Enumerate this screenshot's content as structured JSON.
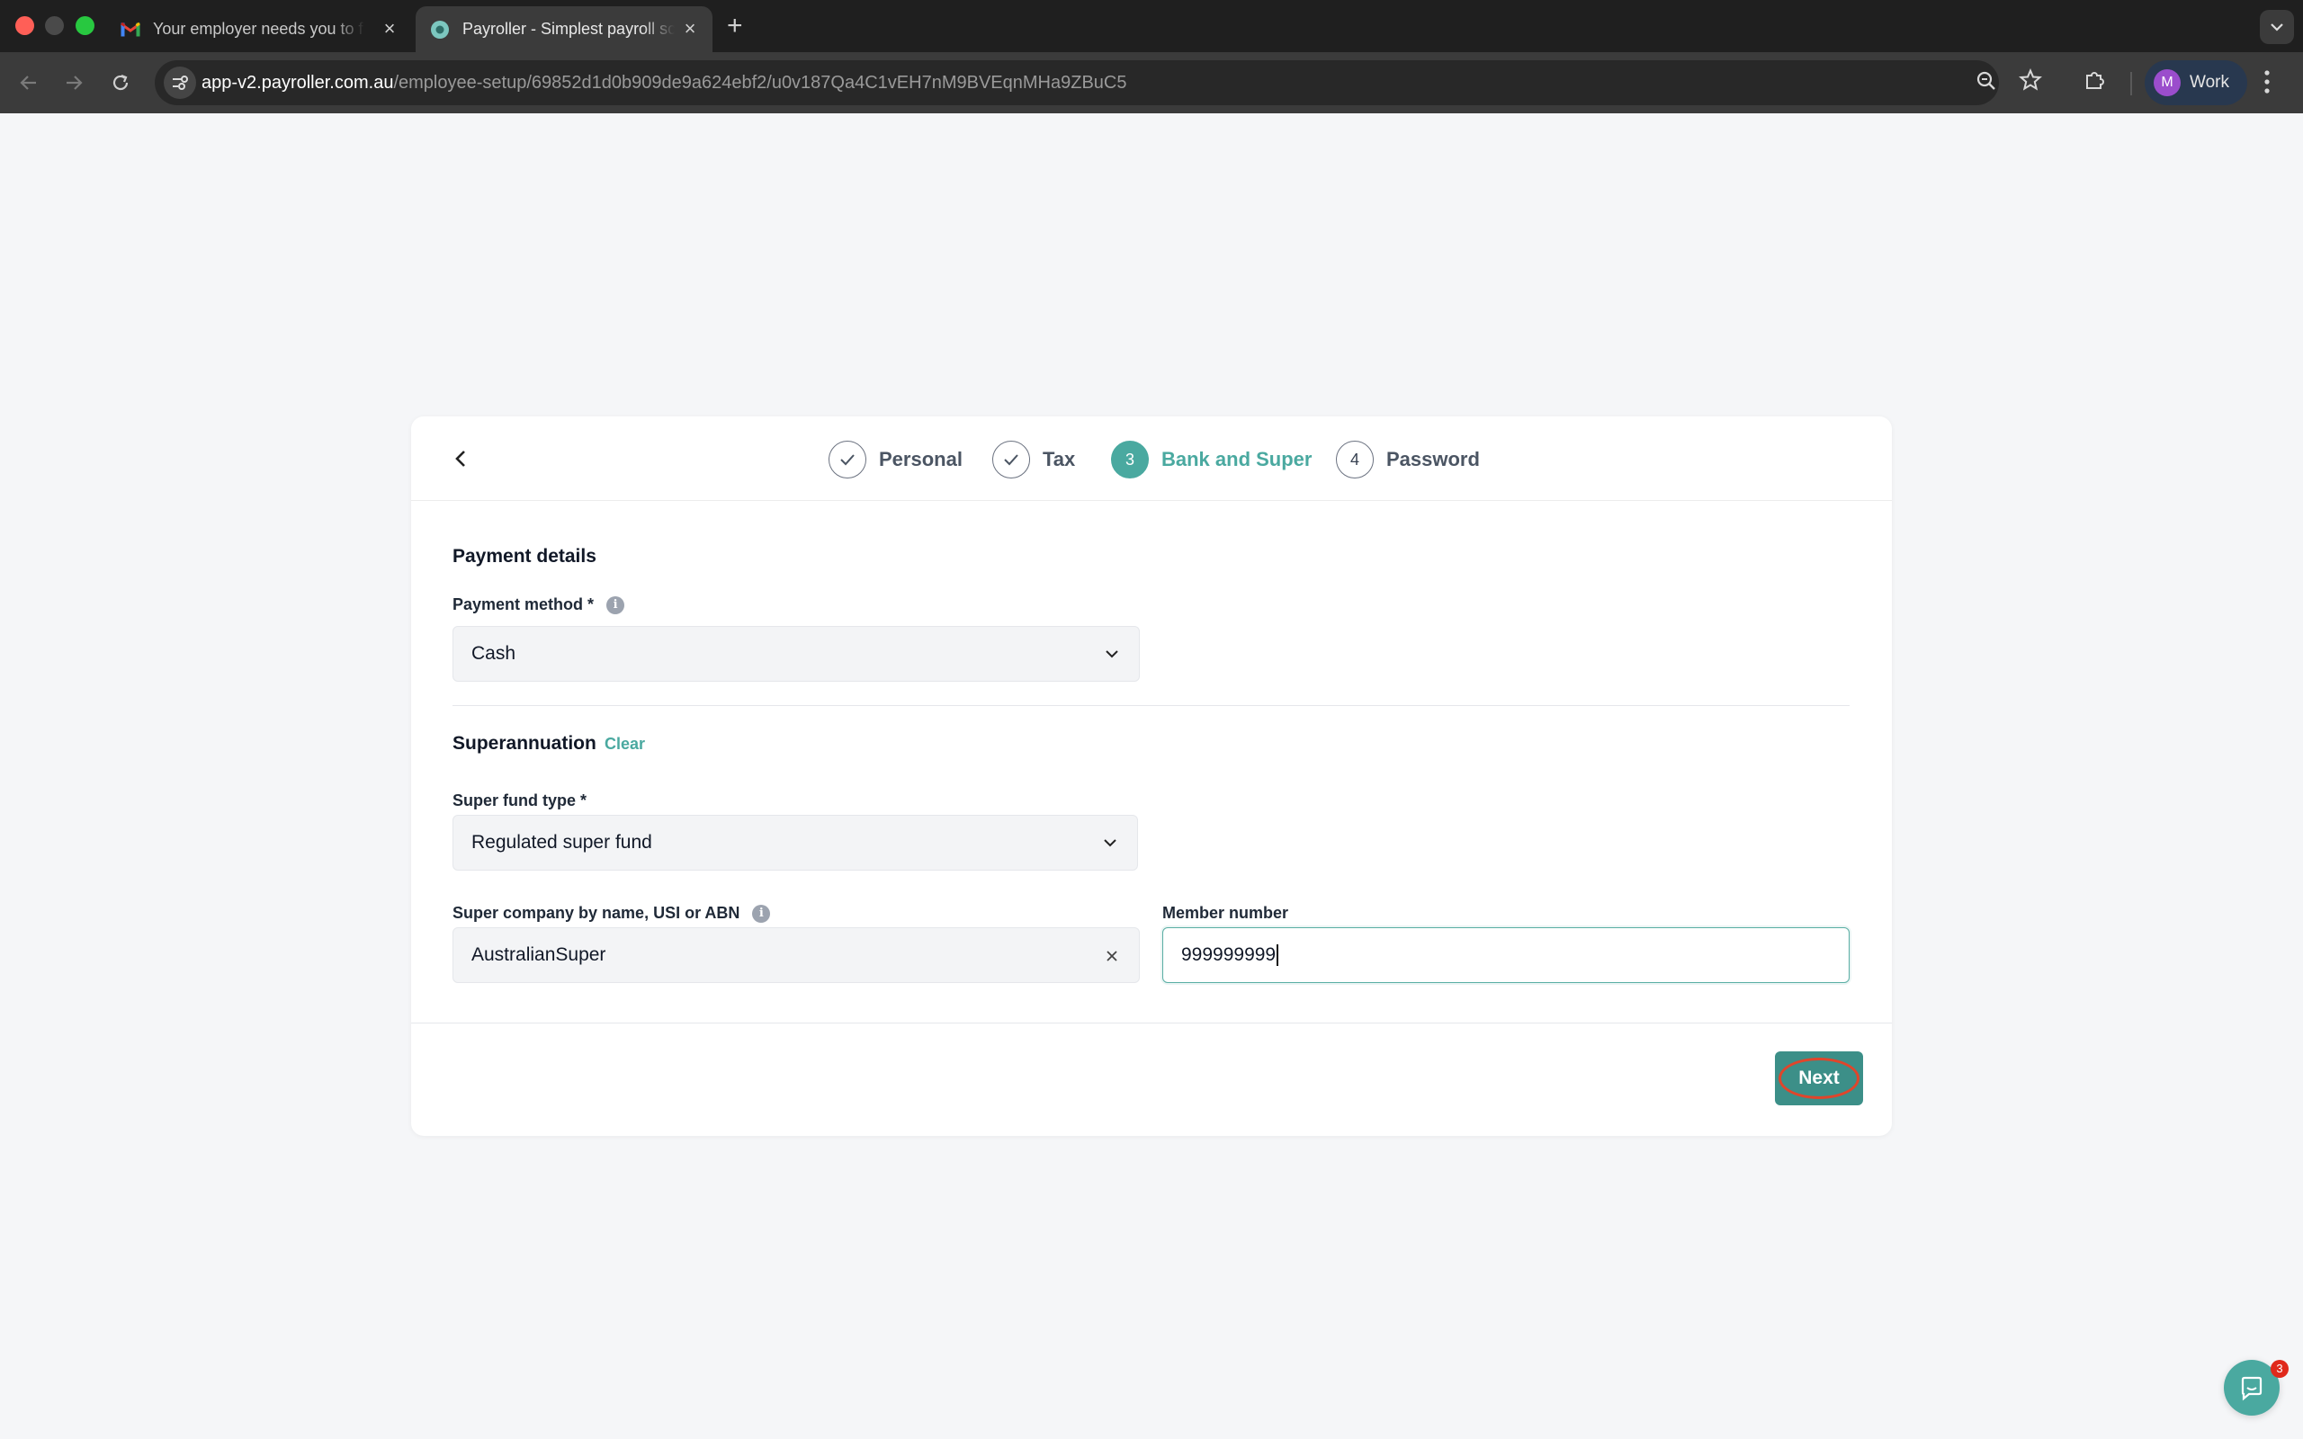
{
  "browser": {
    "tabs": [
      {
        "title": "Your employer needs you to f",
        "icon": "gmail-icon",
        "active": false
      },
      {
        "title": "Payroller - Simplest payroll sc",
        "icon": "payroller-icon",
        "active": true
      }
    ],
    "url_host": "app-v2.payroller.com.au",
    "url_path": "/employee-setup/69852d1d0b909de9a624ebf2/u0v187Qa4C1vEH7nM9BVEqnMHa9ZBuC5",
    "profile": {
      "initial": "M",
      "name": "Work"
    }
  },
  "stepper": {
    "steps": [
      {
        "number": "1",
        "label": "Personal",
        "state": "done"
      },
      {
        "number": "2",
        "label": "Tax",
        "state": "done"
      },
      {
        "number": "3",
        "label": "Bank and Super",
        "state": "active"
      },
      {
        "number": "4",
        "label": "Password",
        "state": "pending"
      }
    ]
  },
  "payment": {
    "section_title": "Payment details",
    "method_label": "Payment method *",
    "method_value": "Cash"
  },
  "super": {
    "section_title": "Superannuation",
    "clear_label": "Clear",
    "fund_type_label": "Super fund type *",
    "fund_type_value": "Regulated super fund",
    "company_label": "Super company by name, USI or ABN",
    "company_value": "AustralianSuper",
    "member_label": "Member number",
    "member_value": "999999999"
  },
  "footer": {
    "next_label": "Next"
  },
  "chat": {
    "badge_count": "3"
  },
  "colors": {
    "accent": "#4aa9a0",
    "button": "#3c8f88",
    "highlight_ring": "#e0452b"
  }
}
